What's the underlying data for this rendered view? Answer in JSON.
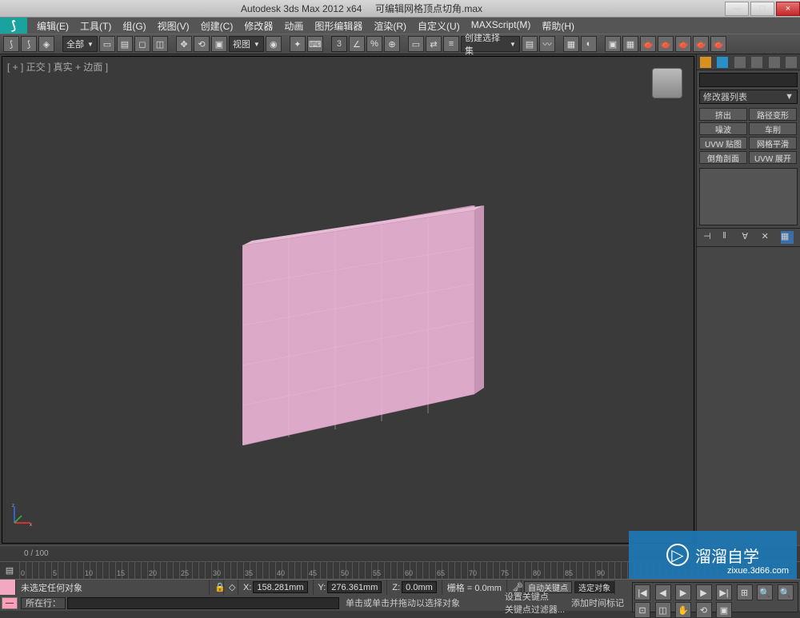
{
  "title": {
    "app": "Autodesk 3ds Max 2012 x64",
    "file": "可编辑网格顶点切角.max"
  },
  "win": {
    "min": "—",
    "max": "□",
    "close": "×"
  },
  "menu": [
    "编辑(E)",
    "工具(T)",
    "组(G)",
    "视图(V)",
    "创建(C)",
    "修改器",
    "动画",
    "图形编辑器",
    "渲染(R)",
    "自定义(U)",
    "MAXScript(M)",
    "帮助(H)"
  ],
  "toolbar": {
    "sel_drop": "全部",
    "view_drop": "视图",
    "create_drop": "创建选择集"
  },
  "viewport": {
    "label": "[ + ] 正交 ] 真实 + 边面 ]"
  },
  "panel": {
    "dropdown": "修改器列表",
    "buttons": [
      "挤出",
      "路径变形",
      "噪波",
      "车削",
      "UVW 贴图",
      "网格平滑",
      "倒角剖面",
      "UVW 展开"
    ]
  },
  "track": {
    "range": "0 / 100"
  },
  "ticks": [
    0,
    5,
    10,
    15,
    20,
    25,
    30,
    35,
    40,
    45,
    50,
    55,
    60,
    65,
    70,
    75,
    80,
    85,
    90
  ],
  "status": {
    "none": "未选定任何对象",
    "xl": "X:",
    "xv": "158.281mm",
    "yl": "Y:",
    "yv": "276.361mm",
    "zl": "Z:",
    "zv": "0.0mm",
    "grid": "栅格 = 0.0mm",
    "autokey": "自动关键点",
    "selkey": "选定对象",
    "setkey": "设置关键点",
    "filter": "关键点过滤器..."
  },
  "cmd": {
    "now": "所在行：",
    "hint": "单击或单击并拖动以选择对象",
    "addtime": "添加时间标记"
  },
  "watermark": {
    "title": "溜溜自学",
    "sub": "zixue.3d66.com"
  }
}
